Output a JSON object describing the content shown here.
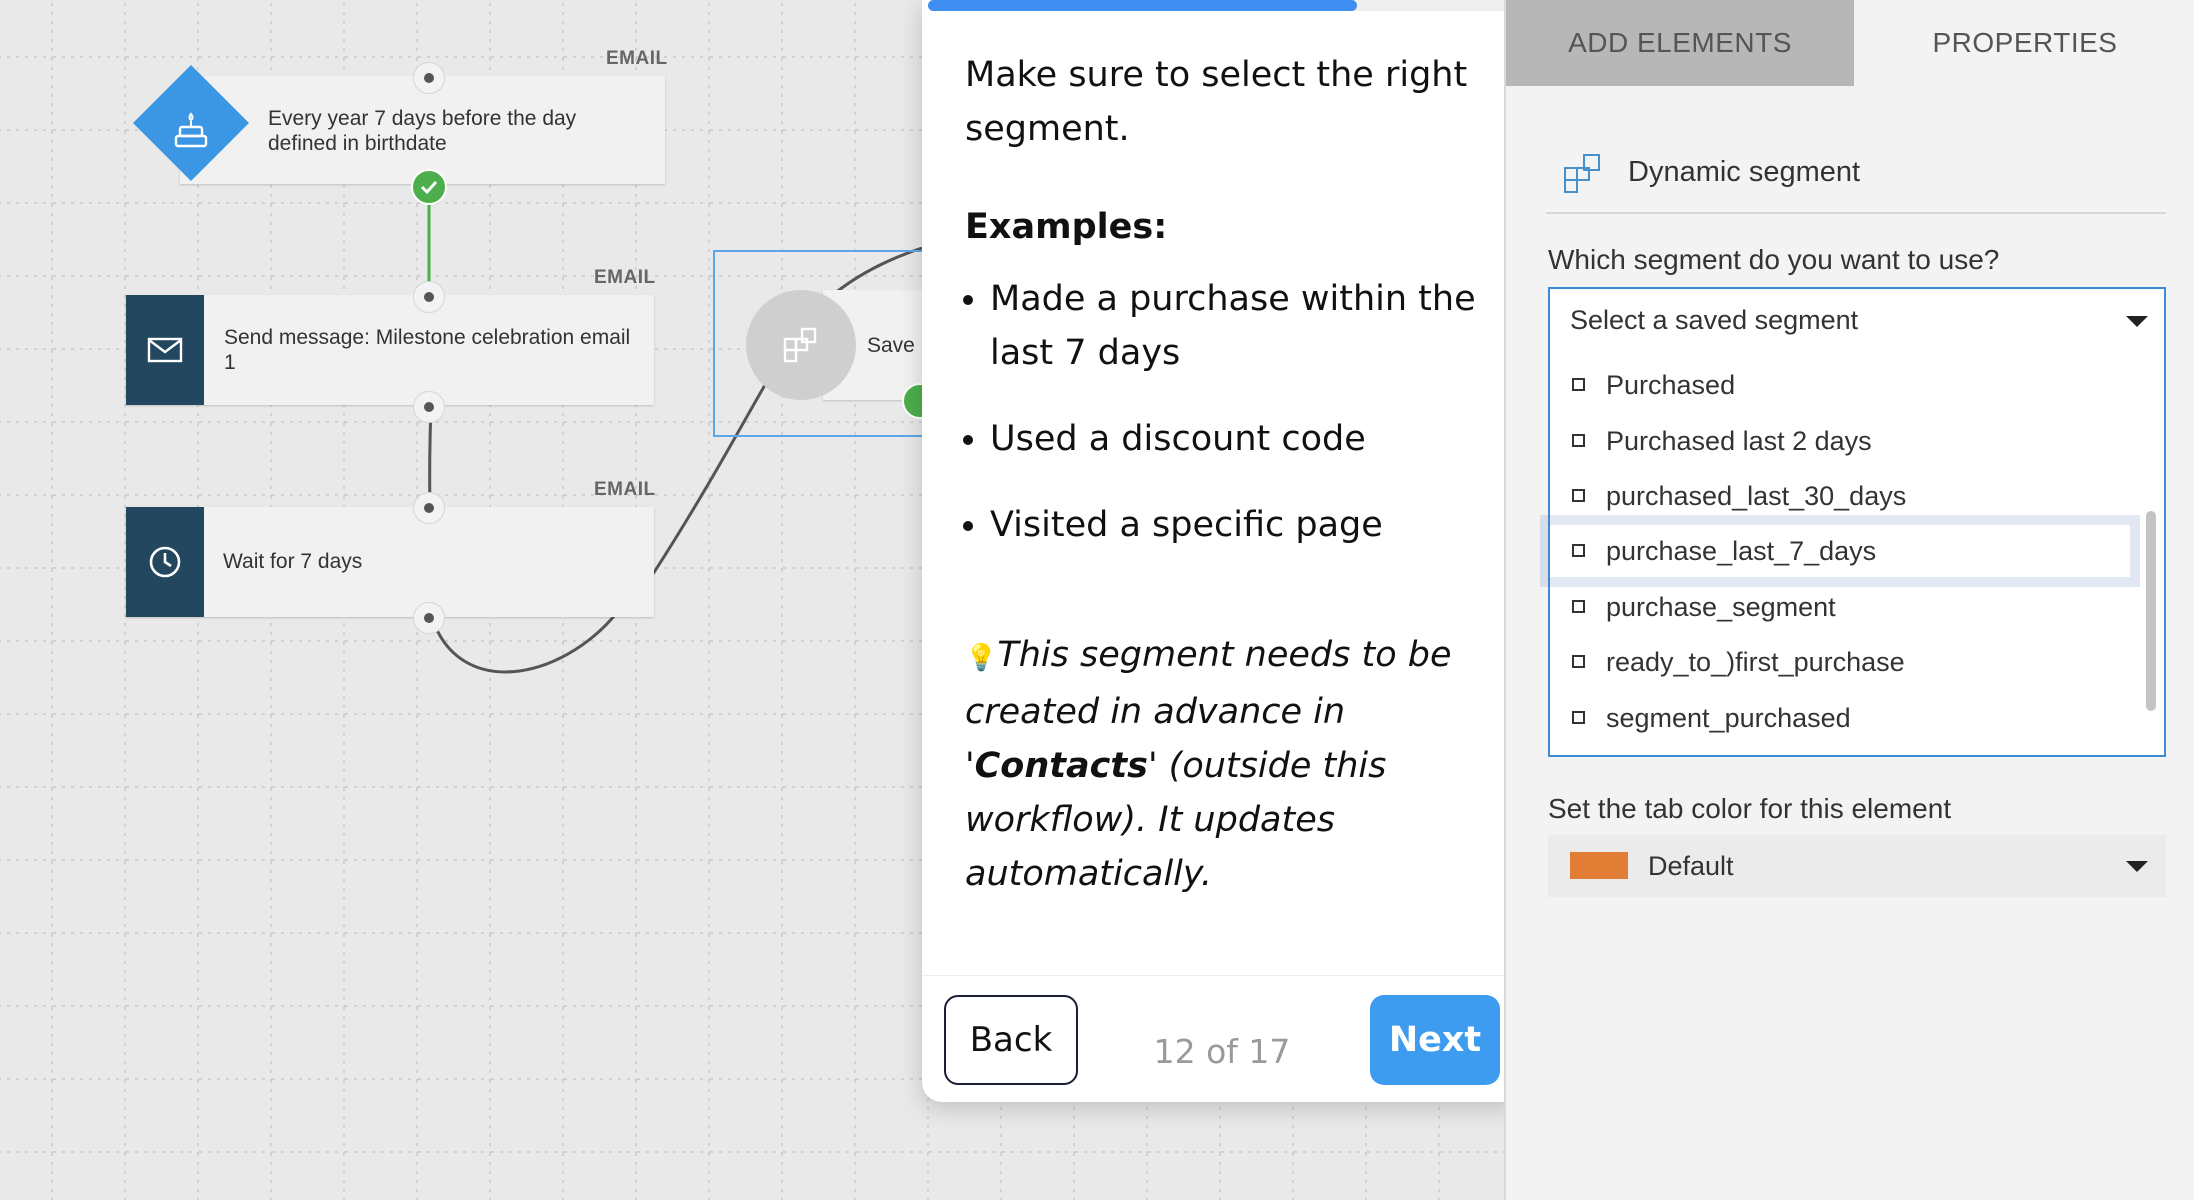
{
  "canvas": {
    "nodes": [
      {
        "tag": "EMAIL",
        "text": "Every year 7 days before the day defined in birthdate",
        "icon": "birthday-cake-icon"
      },
      {
        "tag": "EMAIL",
        "text": "Send message: Milestone celebration email 1",
        "icon": "envelope-icon"
      },
      {
        "tag": "EMAIL",
        "text": "Wait for 7 days",
        "icon": "clock-icon"
      }
    ],
    "segment_node": {
      "text": "Save",
      "icon": "segment-icon"
    }
  },
  "tour": {
    "progress": 0.73,
    "heading": "Make sure to select the right segment.",
    "examples_label": "Examples:",
    "examples": [
      "Made a purchase within the last 7 days",
      "Used a discount code",
      "Visited a specific page"
    ],
    "note_icon": "lightbulb-icon",
    "note_before": "This segment needs to be created in advance in '",
    "note_bold": "Contacts",
    "note_after": "' (outside this workflow). It updates automatically.",
    "back_label": "Back",
    "step_counter": "12 of 17",
    "next_label": "Next"
  },
  "panel": {
    "tabs": [
      {
        "label": "ADD ELEMENTS",
        "active": false
      },
      {
        "label": "PROPERTIES",
        "active": true
      }
    ],
    "element_title": "Dynamic segment",
    "element_icon": "dynamic-segment-icon",
    "segment_question": "Which segment do you want to use?",
    "segment_placeholder": "Select a saved segment",
    "segment_options": [
      "Purchased",
      "Purchased last 2 days",
      "purchased_last_30_days",
      "purchase_last_7_days",
      "purchase_segment",
      "ready_to_)first_purchase",
      "segment_purchased"
    ],
    "highlighted_option": "purchase_last_7_days",
    "tab_color_label": "Set the tab color for this element",
    "tab_color_value": "Default",
    "tab_color_hex": "#e27d35"
  }
}
